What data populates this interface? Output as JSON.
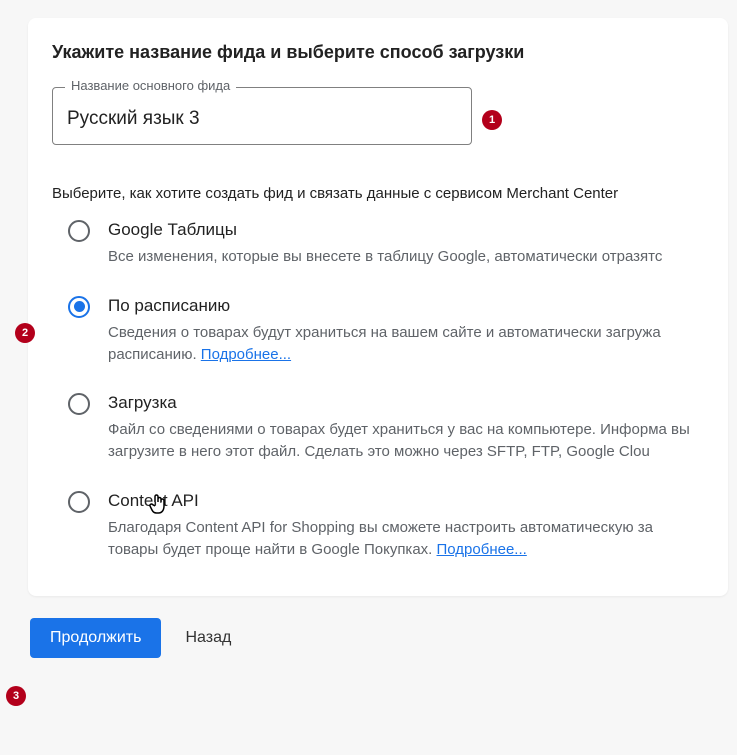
{
  "heading": "Укажите название фида и выберите способ загрузки",
  "feed_name": {
    "label": "Название основного фида",
    "value": "Русский язык 3"
  },
  "instruction": "Выберите, как хотите создать фид и связать данные с сервисом Merchant Center",
  "options": [
    {
      "title": "Google Таблицы",
      "desc": "Все изменения, которые вы внесете в таблицу Google, автоматически отразятс",
      "link": "",
      "selected": false
    },
    {
      "title": "По расписанию",
      "desc": "Сведения о товарах будут храниться на вашем сайте и автоматически загружа расписанию. ",
      "link": "Подробнее...",
      "selected": true
    },
    {
      "title": "Загрузка",
      "desc": "Файл со сведениями о товарах будет храниться у вас на компьютере. Информа вы загрузите в него этот файл. Сделать это можно через SFTP, FTP, Google Clou",
      "link": "",
      "selected": false
    },
    {
      "title": "Content API",
      "desc": "Благодаря Content API for Shopping вы сможете настроить автоматическую за товары будет проще найти в Google Покупках. ",
      "link": "Подробнее...",
      "selected": false
    }
  ],
  "buttons": {
    "continue": "Продолжить",
    "back": "Назад"
  },
  "callouts": [
    "1",
    "2",
    "3"
  ]
}
